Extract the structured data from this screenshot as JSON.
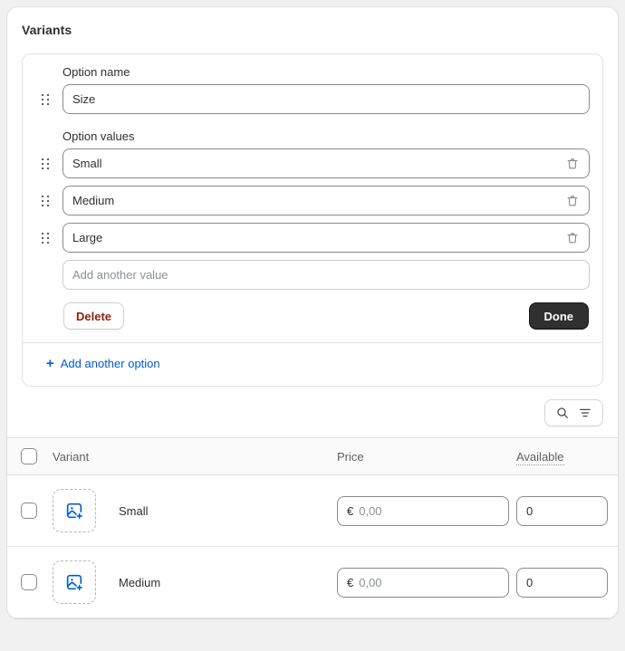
{
  "card": {
    "title": "Variants"
  },
  "option": {
    "name_label": "Option name",
    "name_value": "Size",
    "values_label": "Option values",
    "values": [
      {
        "value": "Small",
        "delete_icon": "trash-icon"
      },
      {
        "value": "Medium",
        "delete_icon": "trash-icon"
      },
      {
        "value": "Large",
        "delete_icon": "trash-icon"
      }
    ],
    "add_value_placeholder": "Add another value",
    "delete_label": "Delete",
    "done_label": "Done",
    "add_option_label": "Add another option",
    "add_option_plus": "+"
  },
  "toolbar": {
    "search_icon": "search-icon",
    "filter_icon": "filter-icon"
  },
  "table": {
    "columns": {
      "variant": "Variant",
      "price": "Price",
      "available": "Available"
    },
    "rows": [
      {
        "name": "Small",
        "image_icon": "add-image-icon",
        "price_currency": "€",
        "price_placeholder": "0,00",
        "available_value": "0"
      },
      {
        "name": "Medium",
        "image_icon": "add-image-icon",
        "price_currency": "€",
        "price_placeholder": "0,00",
        "available_value": "0"
      }
    ]
  },
  "colors": {
    "link": "#005bd3",
    "delete_text": "#8e1f0b",
    "primary_button_bg": "#303030",
    "page_bg": "#f1f1f1",
    "icon_blue": "#005bd3"
  }
}
